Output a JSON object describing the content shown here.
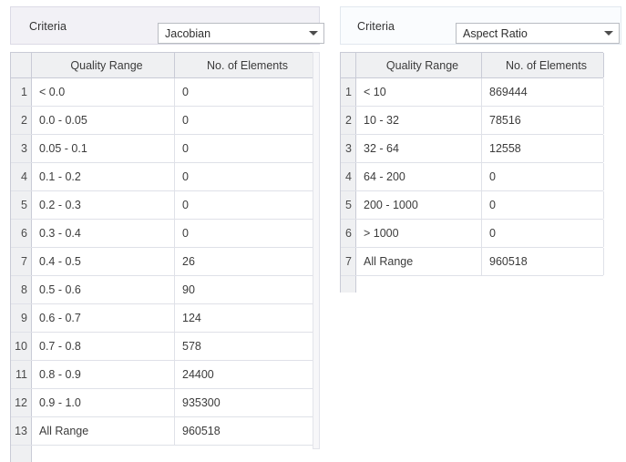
{
  "panels": [
    {
      "id": "left",
      "criteria": {
        "label": "Criteria",
        "selected": "Jacobian",
        "options": [
          "Jacobian"
        ]
      },
      "table": {
        "columns": [
          "",
          "Quality Range",
          "No. of Elements"
        ],
        "rows": [
          {
            "n": "1",
            "range": "< 0.0",
            "count": "0"
          },
          {
            "n": "2",
            "range": "0.0 - 0.05",
            "count": "0"
          },
          {
            "n": "3",
            "range": "0.05 - 0.1",
            "count": "0"
          },
          {
            "n": "4",
            "range": "0.1 - 0.2",
            "count": "0"
          },
          {
            "n": "5",
            "range": "0.2 - 0.3",
            "count": "0"
          },
          {
            "n": "6",
            "range": "0.3 - 0.4",
            "count": "0"
          },
          {
            "n": "7",
            "range": "0.4 - 0.5",
            "count": "26"
          },
          {
            "n": "8",
            "range": "0.5 - 0.6",
            "count": "90"
          },
          {
            "n": "9",
            "range": "0.6 - 0.7",
            "count": "124"
          },
          {
            "n": "10",
            "range": "0.7 - 0.8",
            "count": "578"
          },
          {
            "n": "11",
            "range": "0.8 - 0.9",
            "count": "24400"
          },
          {
            "n": "12",
            "range": "0.9 - 1.0",
            "count": "935300"
          },
          {
            "n": "13",
            "range": "All Range",
            "count": "960518"
          }
        ]
      }
    },
    {
      "id": "right",
      "criteria": {
        "label": "Criteria",
        "selected": "Aspect Ratio",
        "options": [
          "Aspect Ratio"
        ]
      },
      "table": {
        "columns": [
          "",
          "Quality Range",
          "No. of Elements"
        ],
        "rows": [
          {
            "n": "1",
            "range": "< 10",
            "count": "869444"
          },
          {
            "n": "2",
            "range": "10 - 32",
            "count": "78516"
          },
          {
            "n": "3",
            "range": "32 - 64",
            "count": "12558"
          },
          {
            "n": "4",
            "range": "64 - 200",
            "count": "0"
          },
          {
            "n": "5",
            "range": "200 - 1000",
            "count": "0"
          },
          {
            "n": "6",
            "range": "> 1000",
            "count": "0"
          },
          {
            "n": "7",
            "range": "All Range",
            "count": "960518"
          }
        ]
      }
    }
  ],
  "icons": {
    "dropdown_arrow": "chevron-down-icon"
  },
  "colors": {
    "left_group_bg": "#f2f1f6",
    "right_group_bg": "#fafcfe",
    "header_bg": "#eff0f2",
    "grid_line": "#dfe1e8",
    "grid_border": "#c9cbd6",
    "text": "#3b3b3b"
  }
}
